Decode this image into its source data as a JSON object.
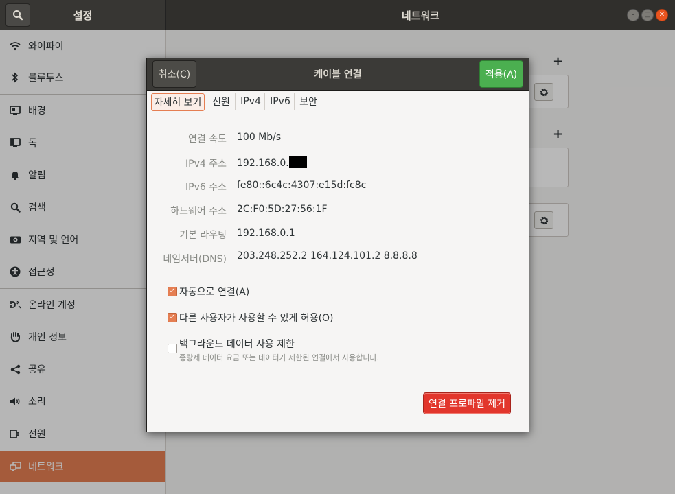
{
  "app": {
    "title": "설정",
    "panel_title": "네트워크"
  },
  "window_buttons": {
    "minimize": "–",
    "maximize": "□",
    "close": "✕"
  },
  "sidebar": {
    "items": [
      {
        "label": "와이파이",
        "icon": "wifi-icon"
      },
      {
        "label": "블루투스",
        "icon": "bluetooth-icon"
      },
      {
        "label": "배경",
        "icon": "background-icon"
      },
      {
        "label": "독",
        "icon": "dock-icon"
      },
      {
        "label": "알림",
        "icon": "bell-icon"
      },
      {
        "label": "검색",
        "icon": "search-icon"
      },
      {
        "label": "지역 및 언어",
        "icon": "region-icon"
      },
      {
        "label": "접근성",
        "icon": "accessibility-icon"
      },
      {
        "label": "온라인 계정",
        "icon": "online-accounts-icon"
      },
      {
        "label": "개인 정보",
        "icon": "privacy-icon"
      },
      {
        "label": "공유",
        "icon": "share-icon"
      },
      {
        "label": "소리",
        "icon": "sound-icon"
      },
      {
        "label": "전원",
        "icon": "power-icon"
      },
      {
        "label": "네트워크",
        "icon": "network-icon",
        "active": true
      }
    ]
  },
  "dialog": {
    "title": "케이블 연결",
    "cancel_label": "취소(C)",
    "apply_label": "적용(A)",
    "tabs": [
      "자세히 보기",
      "신원",
      "IPv4",
      "IPv6",
      "보안"
    ],
    "active_tab": "자세히 보기",
    "details": [
      {
        "label": "연결 속도",
        "value": "100 Mb/s"
      },
      {
        "label": "IPv4 주소",
        "value": "192.168.0."
      },
      {
        "label": "IPv6 주소",
        "value": "fe80::6c4c:4307:e15d:fc8c"
      },
      {
        "label": "하드웨어 주소",
        "value": "2C:F0:5D:27:56:1F"
      },
      {
        "label": "기본 라우팅",
        "value": "192.168.0.1"
      },
      {
        "label": "네임서버(DNS)",
        "value": "203.248.252.2 164.124.101.2 8.8.8.8"
      }
    ],
    "checkboxes": [
      {
        "label": "자동으로 연결(A)",
        "checked": true
      },
      {
        "label": "다른 사용자가 사용할 수 있게 허용(O)",
        "checked": true
      },
      {
        "label": "백그라운드 데이터 사용 제한",
        "checked": false,
        "sublabel": "종량제 데이터 요금 또는 데이터가 제한된 연결에서 사용합니다."
      }
    ],
    "remove_label": "연결 프로파일 제거"
  },
  "background": {
    "add_symbol": "+"
  },
  "colors": {
    "accent": "#e57e52",
    "apply": "#4baf50",
    "destructive": "#e2362c"
  }
}
